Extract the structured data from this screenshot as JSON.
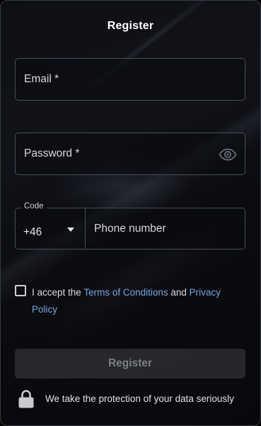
{
  "form": {
    "title": "Register",
    "email_placeholder": "Email *",
    "password_placeholder": "Password *",
    "phone": {
      "code_label": "Code",
      "code_value": "+46",
      "number_placeholder": "Phone number"
    },
    "terms": {
      "prefix": "I accept the ",
      "terms_link": "Terms of Conditions",
      "middle": " and ",
      "privacy_link": "Privacy Policy",
      "checked": false
    },
    "submit_label": "Register",
    "footer_note": "We take the protection of your data seriously"
  },
  "icons": {
    "password_toggle": "eye-icon",
    "code_dropdown": "chevron-down-icon",
    "security": "lock-icon"
  },
  "colors": {
    "link": "#7aa3df",
    "border": "#4a4d56",
    "disabled_button_text": "#7c7e85",
    "background": "#0d0f14"
  }
}
